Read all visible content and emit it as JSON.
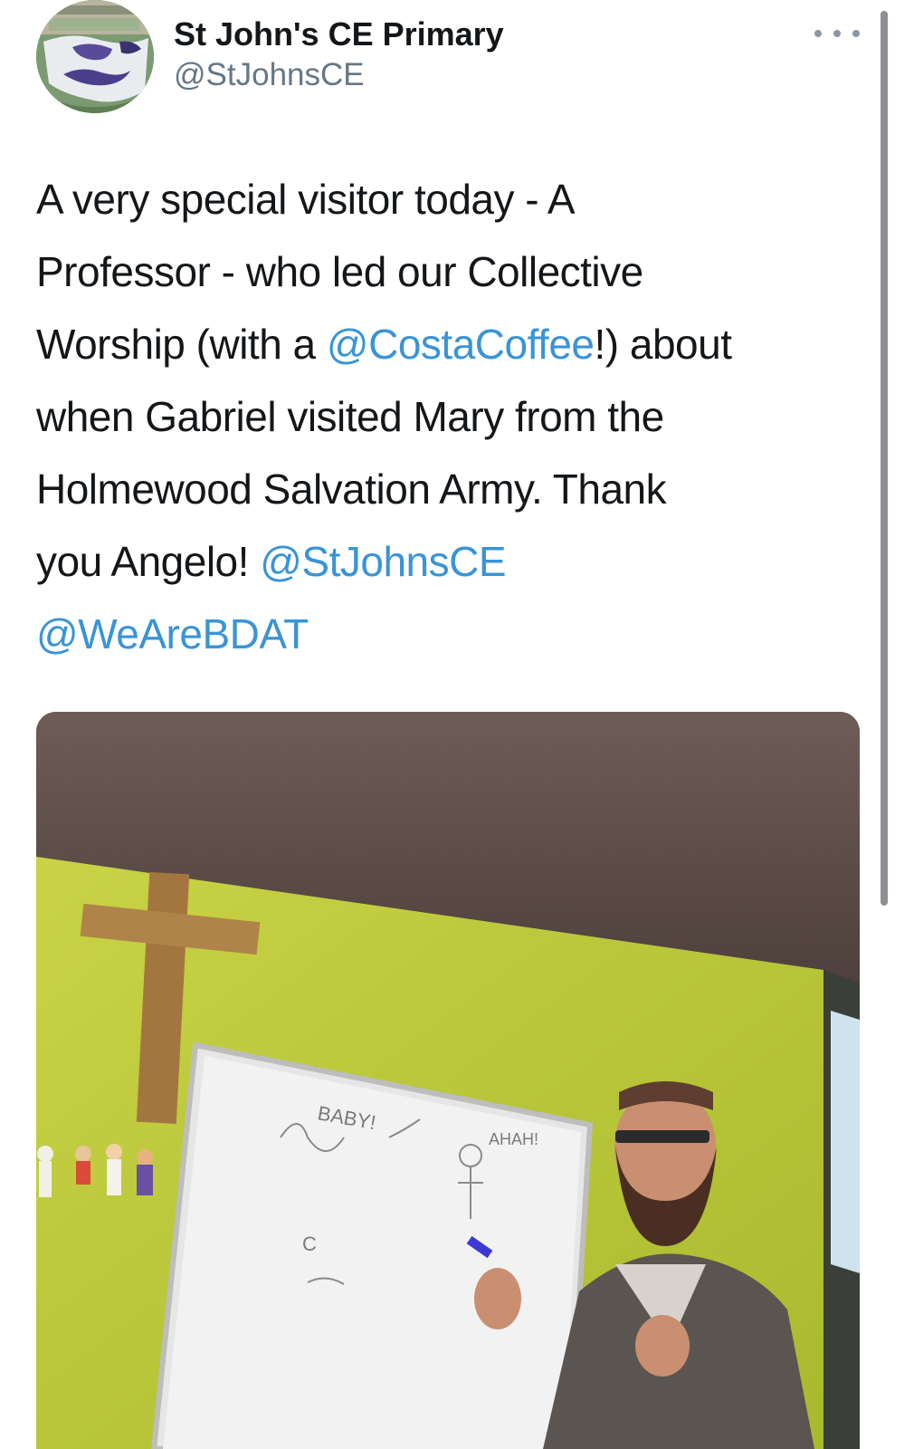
{
  "author": {
    "display_name": "St John's CE Primary",
    "handle": "@StJohnsCE"
  },
  "icons": {
    "more": "more-horizontal-icon",
    "avatar": "school-crest-avatar"
  },
  "tweet": {
    "segments": [
      {
        "line": 0,
        "text": "A very special visitor today - A",
        "type": "text"
      },
      {
        "line": 1,
        "text": "Professor - who led our Collective",
        "type": "text"
      },
      {
        "line": 2,
        "text": "Worship (with a ",
        "type": "text"
      },
      {
        "line": 2,
        "text": "@CostaCoffee",
        "type": "mention"
      },
      {
        "line": 2,
        "text": "!) about",
        "type": "text"
      },
      {
        "line": 3,
        "text": "when Gabriel visited Mary from the",
        "type": "text"
      },
      {
        "line": 4,
        "text": "Holmewood Salvation Army. Thank",
        "type": "text"
      },
      {
        "line": 5,
        "text": "you Angelo! ",
        "type": "text"
      },
      {
        "line": 5,
        "text": "@StJohnsCE",
        "type": "mention"
      },
      {
        "line": 6,
        "text": "@WeAreBDAT",
        "type": "mention"
      }
    ]
  },
  "media": {
    "whiteboard_labels": [
      "BABY!",
      "AHAH!",
      "C"
    ]
  },
  "colors": {
    "text": "#14171a",
    "secondary": "#657786",
    "link": "#3a94d6",
    "wall": "#c4cf3a"
  }
}
